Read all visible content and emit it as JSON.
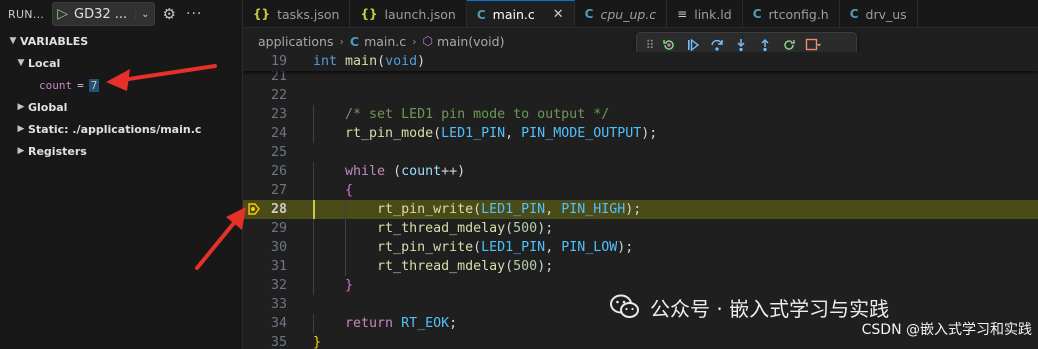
{
  "run_bar": {
    "title": "RUN...",
    "play_icon": "play-icon",
    "config": "GD32 ...",
    "chevron": "chevron-down-icon",
    "gear": "gear-icon",
    "more": "ellipsis-icon"
  },
  "variables": {
    "header": "VARIABLES",
    "local_label": "Local",
    "local_vars": [
      {
        "name": "count",
        "value": "7"
      }
    ],
    "scopes": [
      "Global",
      "Static: ./applications/main.c",
      "Registers"
    ]
  },
  "tabs": [
    {
      "icon": "{}",
      "label": "tasks.json",
      "kind": "json",
      "active": false,
      "italic": false
    },
    {
      "icon": "{}",
      "label": "launch.json",
      "kind": "json",
      "active": false,
      "italic": false
    },
    {
      "icon": "C",
      "label": "main.c",
      "kind": "c",
      "active": true,
      "italic": false
    },
    {
      "icon": "C",
      "label": "cpu_up.c",
      "kind": "c",
      "active": false,
      "italic": true
    },
    {
      "icon": "≡",
      "label": "link.ld",
      "kind": "ld",
      "active": false,
      "italic": false
    },
    {
      "icon": "C",
      "label": "rtconfig.h",
      "kind": "c",
      "active": false,
      "italic": false
    },
    {
      "icon": "C",
      "label": "drv_us",
      "kind": "c",
      "active": false,
      "italic": false
    }
  ],
  "close_glyph": "✕",
  "breadcrumb": {
    "folder": "applications",
    "file_icon": "C",
    "file": "main.c",
    "symbol": "main(void)"
  },
  "debug_toolbar": [
    "drag-handle-icon",
    "restart-frame-icon",
    "continue-icon",
    "step-over-icon",
    "step-into-icon",
    "step-out-icon",
    "restart-icon",
    "stop-icon"
  ],
  "editor": {
    "current_line": 28,
    "sticky": {
      "n": "19",
      "parts": [
        [
          "kw",
          "int"
        ],
        [
          "",
          " "
        ],
        [
          "fn",
          "main"
        ],
        [
          "",
          "("
        ],
        [
          "kw",
          "void"
        ],
        [
          "",
          ")"
        ]
      ]
    },
    "lines": [
      {
        "n": "21",
        "indent": 0,
        "parts": []
      },
      {
        "n": "22",
        "indent": 0,
        "parts": []
      },
      {
        "n": "23",
        "indent": 1,
        "parts": [
          [
            "",
            "    "
          ],
          [
            "cm",
            "/* set LED1 pin mode to output */"
          ]
        ]
      },
      {
        "n": "24",
        "indent": 1,
        "parts": [
          [
            "",
            "    "
          ],
          [
            "fn",
            "rt_pin_mode"
          ],
          [
            "",
            "("
          ],
          [
            "mc",
            "LED1_PIN"
          ],
          [
            "",
            ", "
          ],
          [
            "mc",
            "PIN_MODE_OUTPUT"
          ],
          [
            "",
            ");"
          ]
        ]
      },
      {
        "n": "25",
        "indent": 0,
        "parts": []
      },
      {
        "n": "26",
        "indent": 1,
        "parts": [
          [
            "",
            "    "
          ],
          [
            "kw2",
            "while"
          ],
          [
            "",
            " ("
          ],
          [
            "vr",
            "count"
          ],
          [
            "",
            "++)"
          ]
        ]
      },
      {
        "n": "27",
        "indent": 1,
        "parts": [
          [
            "",
            "    "
          ],
          [
            "br2",
            "{"
          ]
        ]
      },
      {
        "n": "28",
        "indent": 2,
        "parts": [
          [
            "",
            "        "
          ],
          [
            "fn",
            "rt_pin_write"
          ],
          [
            "",
            "("
          ],
          [
            "mc",
            "LED1_PIN"
          ],
          [
            "",
            ", "
          ],
          [
            "mc",
            "PIN_HIGH"
          ],
          [
            "",
            ");"
          ]
        ]
      },
      {
        "n": "29",
        "indent": 2,
        "parts": [
          [
            "",
            "        "
          ],
          [
            "fn",
            "rt_thread_mdelay"
          ],
          [
            "",
            "("
          ],
          [
            "nm",
            "500"
          ],
          [
            "",
            ");"
          ]
        ]
      },
      {
        "n": "30",
        "indent": 2,
        "parts": [
          [
            "",
            "        "
          ],
          [
            "fn",
            "rt_pin_write"
          ],
          [
            "",
            "("
          ],
          [
            "mc",
            "LED1_PIN"
          ],
          [
            "",
            ", "
          ],
          [
            "mc",
            "PIN_LOW"
          ],
          [
            "",
            ");"
          ]
        ]
      },
      {
        "n": "31",
        "indent": 2,
        "parts": [
          [
            "",
            "        "
          ],
          [
            "fn",
            "rt_thread_mdelay"
          ],
          [
            "",
            "("
          ],
          [
            "nm",
            "500"
          ],
          [
            "",
            ");"
          ]
        ]
      },
      {
        "n": "32",
        "indent": 1,
        "parts": [
          [
            "",
            "    "
          ],
          [
            "br2",
            "}"
          ]
        ]
      },
      {
        "n": "33",
        "indent": 0,
        "parts": []
      },
      {
        "n": "34",
        "indent": 1,
        "parts": [
          [
            "",
            "    "
          ],
          [
            "kw2",
            "return"
          ],
          [
            "",
            " "
          ],
          [
            "mc",
            "RT_EOK"
          ],
          [
            "",
            ";"
          ]
        ]
      },
      {
        "n": "35",
        "indent": 0,
        "parts": [
          [
            "br1",
            "}"
          ]
        ]
      }
    ]
  },
  "watermark": {
    "wechat": "公众号 · 嵌入式学习与实践",
    "csdn": "CSDN @嵌入式学习和实践"
  },
  "colors": {
    "annotation_arrow": "#e8302a",
    "highlight_line": "#4b4b18",
    "accent": "#0078d4"
  }
}
